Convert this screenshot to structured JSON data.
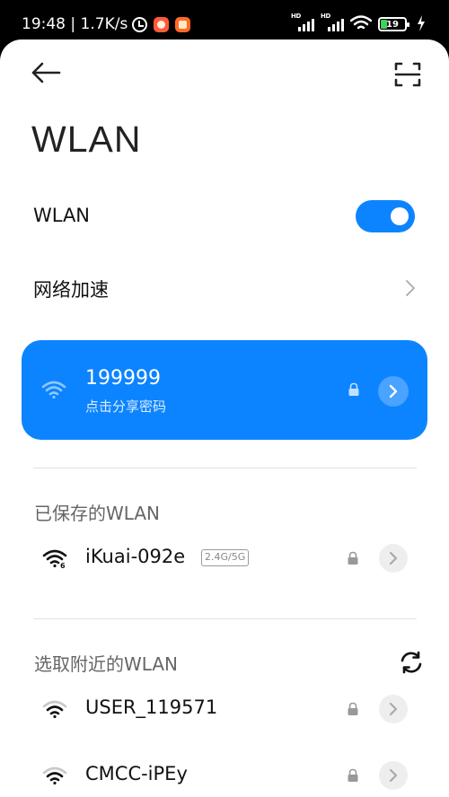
{
  "status_bar": {
    "time": "19:48",
    "network_speed": "1.7K/s",
    "sim1_label": "HD",
    "sim2_label": "HD",
    "battery": "19",
    "icons": [
      "alarm-icon",
      "app-notification-icon",
      "app-notification-icon",
      "signal-icon",
      "signal-icon",
      "wifi-icon",
      "battery-icon",
      "charging-icon"
    ]
  },
  "header": {
    "back_icon": "back-arrow-icon",
    "scan_icon": "scan-icon",
    "title": "WLAN"
  },
  "wlan_toggle": {
    "label": "WLAN",
    "enabled": true
  },
  "network_acceleration": {
    "label": "网络加速",
    "icon": "chevron-right-icon"
  },
  "connected_network": {
    "ssid": "199999",
    "subtitle": "点击分享密码",
    "secured": true,
    "accent_color": "#0d84ff"
  },
  "saved_networks": {
    "title": "已保存的WLAN",
    "items": [
      {
        "ssid": "iKuai-092e",
        "band": "2.4G/5G",
        "wifi_generation": "6",
        "secured": true
      }
    ]
  },
  "nearby_networks": {
    "title": "选取附近的WLAN",
    "refresh_icon": "refresh-icon",
    "items": [
      {
        "ssid": "USER_119571",
        "secured": true
      },
      {
        "ssid": "CMCC-iPEy",
        "secured": true
      }
    ]
  }
}
